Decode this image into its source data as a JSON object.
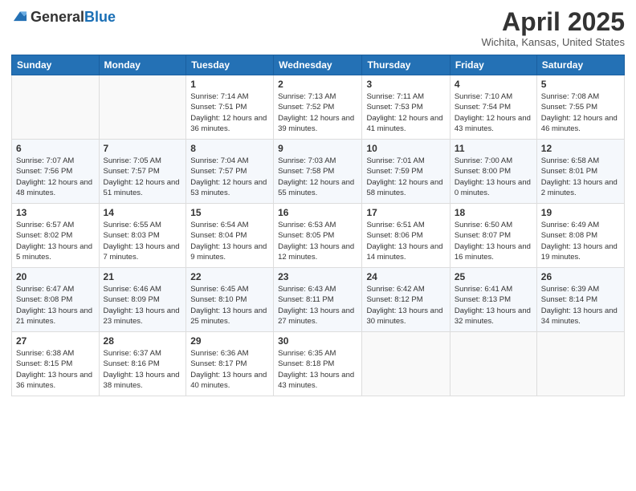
{
  "header": {
    "logo_general": "General",
    "logo_blue": "Blue",
    "month_title": "April 2025",
    "location": "Wichita, Kansas, United States"
  },
  "calendar": {
    "weekdays": [
      "Sunday",
      "Monday",
      "Tuesday",
      "Wednesday",
      "Thursday",
      "Friday",
      "Saturday"
    ],
    "weeks": [
      [
        {
          "day": "",
          "info": ""
        },
        {
          "day": "",
          "info": ""
        },
        {
          "day": "1",
          "info": "Sunrise: 7:14 AM\nSunset: 7:51 PM\nDaylight: 12 hours and 36 minutes."
        },
        {
          "day": "2",
          "info": "Sunrise: 7:13 AM\nSunset: 7:52 PM\nDaylight: 12 hours and 39 minutes."
        },
        {
          "day": "3",
          "info": "Sunrise: 7:11 AM\nSunset: 7:53 PM\nDaylight: 12 hours and 41 minutes."
        },
        {
          "day": "4",
          "info": "Sunrise: 7:10 AM\nSunset: 7:54 PM\nDaylight: 12 hours and 43 minutes."
        },
        {
          "day": "5",
          "info": "Sunrise: 7:08 AM\nSunset: 7:55 PM\nDaylight: 12 hours and 46 minutes."
        }
      ],
      [
        {
          "day": "6",
          "info": "Sunrise: 7:07 AM\nSunset: 7:56 PM\nDaylight: 12 hours and 48 minutes."
        },
        {
          "day": "7",
          "info": "Sunrise: 7:05 AM\nSunset: 7:57 PM\nDaylight: 12 hours and 51 minutes."
        },
        {
          "day": "8",
          "info": "Sunrise: 7:04 AM\nSunset: 7:57 PM\nDaylight: 12 hours and 53 minutes."
        },
        {
          "day": "9",
          "info": "Sunrise: 7:03 AM\nSunset: 7:58 PM\nDaylight: 12 hours and 55 minutes."
        },
        {
          "day": "10",
          "info": "Sunrise: 7:01 AM\nSunset: 7:59 PM\nDaylight: 12 hours and 58 minutes."
        },
        {
          "day": "11",
          "info": "Sunrise: 7:00 AM\nSunset: 8:00 PM\nDaylight: 13 hours and 0 minutes."
        },
        {
          "day": "12",
          "info": "Sunrise: 6:58 AM\nSunset: 8:01 PM\nDaylight: 13 hours and 2 minutes."
        }
      ],
      [
        {
          "day": "13",
          "info": "Sunrise: 6:57 AM\nSunset: 8:02 PM\nDaylight: 13 hours and 5 minutes."
        },
        {
          "day": "14",
          "info": "Sunrise: 6:55 AM\nSunset: 8:03 PM\nDaylight: 13 hours and 7 minutes."
        },
        {
          "day": "15",
          "info": "Sunrise: 6:54 AM\nSunset: 8:04 PM\nDaylight: 13 hours and 9 minutes."
        },
        {
          "day": "16",
          "info": "Sunrise: 6:53 AM\nSunset: 8:05 PM\nDaylight: 13 hours and 12 minutes."
        },
        {
          "day": "17",
          "info": "Sunrise: 6:51 AM\nSunset: 8:06 PM\nDaylight: 13 hours and 14 minutes."
        },
        {
          "day": "18",
          "info": "Sunrise: 6:50 AM\nSunset: 8:07 PM\nDaylight: 13 hours and 16 minutes."
        },
        {
          "day": "19",
          "info": "Sunrise: 6:49 AM\nSunset: 8:08 PM\nDaylight: 13 hours and 19 minutes."
        }
      ],
      [
        {
          "day": "20",
          "info": "Sunrise: 6:47 AM\nSunset: 8:08 PM\nDaylight: 13 hours and 21 minutes."
        },
        {
          "day": "21",
          "info": "Sunrise: 6:46 AM\nSunset: 8:09 PM\nDaylight: 13 hours and 23 minutes."
        },
        {
          "day": "22",
          "info": "Sunrise: 6:45 AM\nSunset: 8:10 PM\nDaylight: 13 hours and 25 minutes."
        },
        {
          "day": "23",
          "info": "Sunrise: 6:43 AM\nSunset: 8:11 PM\nDaylight: 13 hours and 27 minutes."
        },
        {
          "day": "24",
          "info": "Sunrise: 6:42 AM\nSunset: 8:12 PM\nDaylight: 13 hours and 30 minutes."
        },
        {
          "day": "25",
          "info": "Sunrise: 6:41 AM\nSunset: 8:13 PM\nDaylight: 13 hours and 32 minutes."
        },
        {
          "day": "26",
          "info": "Sunrise: 6:39 AM\nSunset: 8:14 PM\nDaylight: 13 hours and 34 minutes."
        }
      ],
      [
        {
          "day": "27",
          "info": "Sunrise: 6:38 AM\nSunset: 8:15 PM\nDaylight: 13 hours and 36 minutes."
        },
        {
          "day": "28",
          "info": "Sunrise: 6:37 AM\nSunset: 8:16 PM\nDaylight: 13 hours and 38 minutes."
        },
        {
          "day": "29",
          "info": "Sunrise: 6:36 AM\nSunset: 8:17 PM\nDaylight: 13 hours and 40 minutes."
        },
        {
          "day": "30",
          "info": "Sunrise: 6:35 AM\nSunset: 8:18 PM\nDaylight: 13 hours and 43 minutes."
        },
        {
          "day": "",
          "info": ""
        },
        {
          "day": "",
          "info": ""
        },
        {
          "day": "",
          "info": ""
        }
      ]
    ]
  }
}
